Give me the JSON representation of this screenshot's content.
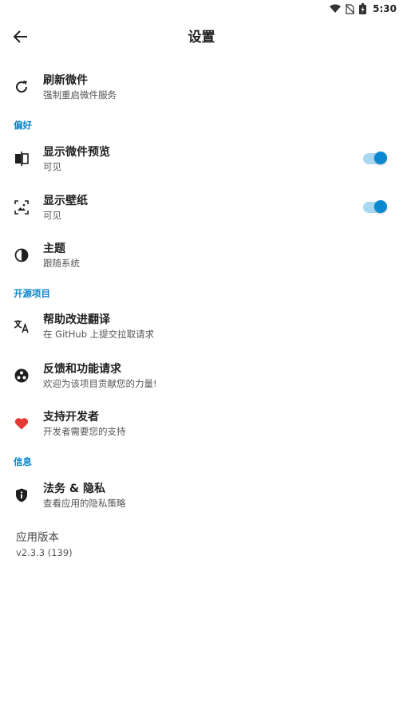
{
  "status": {
    "time": "5:30"
  },
  "app_bar": {
    "title": "设置"
  },
  "refresh": {
    "title": "刷新微件",
    "subtitle": "强制重启微件服务"
  },
  "sections": {
    "preferences": "偏好",
    "open_source": "开源项目",
    "info": "信息"
  },
  "preview": {
    "title": "显示微件预览",
    "subtitle": "可见",
    "enabled": true
  },
  "wallpaper": {
    "title": "显示壁纸",
    "subtitle": "可见",
    "enabled": true
  },
  "theme": {
    "title": "主题",
    "subtitle": "跟随系统"
  },
  "translate": {
    "title": "帮助改进翻译",
    "subtitle": "在 GitHub 上提交拉取请求"
  },
  "feedback": {
    "title": "反馈和功能请求",
    "subtitle": "欢迎为该项目贡献您的力量!"
  },
  "support": {
    "title": "支持开发者",
    "subtitle": "开发者需要您的支持"
  },
  "legal": {
    "title": "法务 & 隐私",
    "subtitle": "查看应用的隐私策略"
  },
  "version": {
    "title": "应用版本",
    "value": "v2.3.3 (139)"
  },
  "colors": {
    "accent": "#0a84c8",
    "heart": "#e53935",
    "toggle_thumb": "#0a89d0",
    "toggle_track": "#a9d9f1"
  }
}
